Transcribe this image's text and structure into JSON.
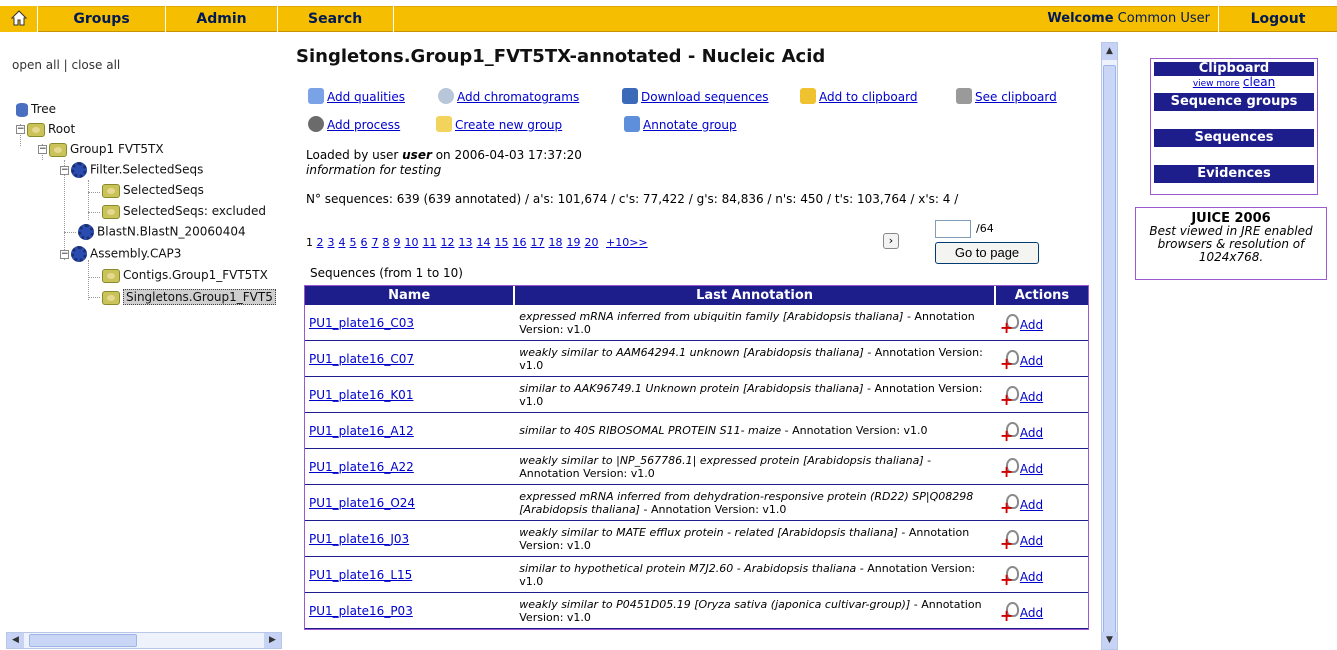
{
  "nav": {
    "groups": "Groups",
    "admin": "Admin",
    "search": "Search",
    "welcome_bold": "Welcome",
    "welcome_user": "Common User",
    "logout": "Logout"
  },
  "tree": {
    "open_all": "open all",
    "sep": "|",
    "close_all": "close all",
    "nodes": {
      "tree": "Tree",
      "root": "Root",
      "group1": "Group1 FVT5TX",
      "filter": "Filter.SelectedSeqs",
      "selected": "SelectedSeqs",
      "selected_excl": "SelectedSeqs: excluded",
      "blastn": "BlastN.BlastN_20060404",
      "assembly": "Assembly.CAP3",
      "contigs": "Contigs.Group1_FVT5TX",
      "singletons": "Singletons.Group1_FVT5"
    }
  },
  "main": {
    "title": "Singletons.Group1_FVT5TX-annotated - Nucleic Acid",
    "actions": {
      "add_qualities": "Add qualities",
      "add_chromatograms": "Add chromatograms",
      "download_sequences": "Download sequences",
      "add_clipboard": "Add to clipboard",
      "see_clipboard": "See clipboard",
      "add_process": "Add process",
      "create_group": "Create new group",
      "annotate_group": "Annotate group"
    },
    "loaded_prefix": "Loaded by user",
    "loaded_user": "user",
    "loaded_suffix": "on 2006-04-03 17:37:20",
    "loaded_note": "information for testing",
    "stats": "N° sequences: 639 (639 annotated) / a's: 101,674 / c's: 77,422 / g's: 84,836 / n's: 450 / t's: 103,764 / x's: 4 /",
    "pager": {
      "current": "1",
      "pages": [
        "2",
        "3",
        "4",
        "5",
        "6",
        "7",
        "8",
        "9",
        "10",
        "11",
        "12",
        "13",
        "14",
        "15",
        "16",
        "17",
        "18",
        "19",
        "20"
      ],
      "more": "+10>>",
      "total": "/64",
      "goto": "Go to page"
    },
    "table_caption": "Sequences (from 1 to 10)",
    "table": {
      "headers": [
        "Name",
        "Last Annotation",
        "Actions"
      ],
      "add_label": "Add",
      "rows": [
        {
          "name": "PU1_plate16_C03",
          "ann_it": "expressed mRNA inferred from ubiquitin family [Arabidopsis thaliana]",
          "ann_rest": " - Annotation Version: v1.0"
        },
        {
          "name": "PU1_plate16_C07",
          "ann_it": "weakly similar to AAM64294.1 unknown [Arabidopsis thaliana]",
          "ann_rest": " - Annotation Version: v1.0"
        },
        {
          "name": "PU1_plate16_K01",
          "ann_it": "similar to AAK96749.1 Unknown protein [Arabidopsis thaliana]",
          "ann_rest": " - Annotation Version: v1.0"
        },
        {
          "name": "PU1_plate16_A12",
          "ann_it": "similar to 40S RIBOSOMAL PROTEIN S11- maize",
          "ann_rest": " - Annotation Version: v1.0"
        },
        {
          "name": "PU1_plate16_A22",
          "ann_it": "weakly similar to |NP_567786.1| expressed protein [Arabidopsis thaliana]",
          "ann_rest": " - Annotation Version: v1.0"
        },
        {
          "name": "PU1_plate16_O24",
          "ann_it": "expressed mRNA inferred from dehydration-responsive protein (RD22) SP|Q08298 [Arabidopsis thaliana]",
          "ann_rest": " - Annotation Version: v1.0"
        },
        {
          "name": "PU1_plate16_J03",
          "ann_it": "weakly similar to MATE efflux protein - related [Arabidopsis thaliana]",
          "ann_rest": " - Annotation Version: v1.0"
        },
        {
          "name": "PU1_plate16_L15",
          "ann_it": "similar to hypothetical protein M7J2.60 - Arabidopsis thaliana -",
          "ann_rest": " Annotation Version: v1.0"
        },
        {
          "name": "PU1_plate16_P03",
          "ann_it": "weakly similar to P0451D05.19 [Oryza sativa (japonica cultivar-group)]",
          "ann_rest": " - Annotation Version: v1.0"
        }
      ]
    }
  },
  "clipboard": {
    "title": "Clipboard",
    "view_more": "view more",
    "clean": "clean",
    "sequence_groups": "Sequence groups",
    "sequences": "Sequences",
    "evidences": "Evidences"
  },
  "juice": {
    "title": "JUICE 2006",
    "note": "Best viewed in JRE enabled browsers & resolution of 1024x768."
  }
}
